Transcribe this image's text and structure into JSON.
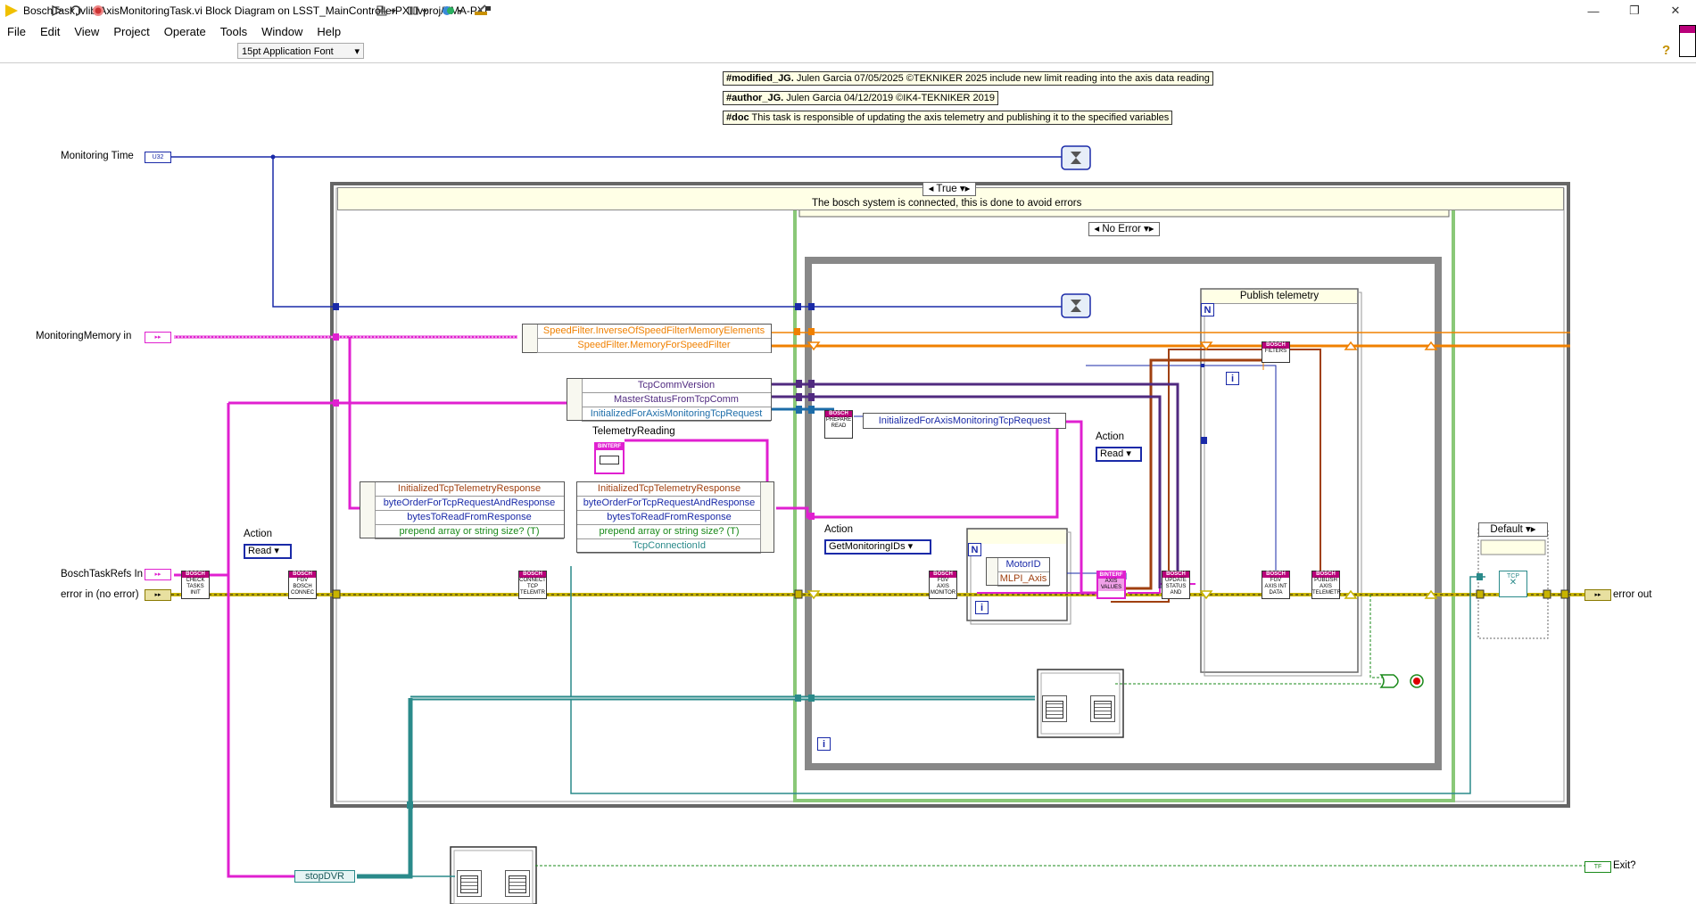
{
  "window": {
    "title": "BoschTask.lvlib:AxisMonitoringTask.vi Block Diagram on LSST_MainControllerPXI.lvproj/TMA-PXI",
    "controls": [
      "—",
      "❐",
      "✕"
    ]
  },
  "menu": [
    "File",
    "Edit",
    "View",
    "Project",
    "Operate",
    "Tools",
    "Window",
    "Help"
  ],
  "toolbar": {
    "font": "15pt Application Font",
    "icons": [
      "run-arrow-icon",
      "run-continuous-icon",
      "abort-icon",
      "align-icon",
      "distribute-icon",
      "reorder-icon",
      "cleanup-icon"
    ],
    "help": "?"
  },
  "comments": [
    {
      "tag": "#modified_JG.",
      "text": " Julen Garcia 07/05/2025 ©TEKNIKER 2025 include new limit reading into the axis data reading"
    },
    {
      "tag": "#author_JG.",
      "text": " Julen Garcia 04/12/2019 ©IK4-TEKNIKER 2019"
    },
    {
      "tag": "#doc",
      "text": " This task is responsible of updating the axis telemetry and publishing it to the specified variables"
    }
  ],
  "terminals": {
    "monitoring_time": "Monitoring Time",
    "monitoring_time_type": "U32",
    "monitoring_memory": "MonitoringMemory in",
    "bosch_task_refs": "BoschTaskRefs In",
    "error_in": "error in (no error)",
    "error_out": "error out",
    "exit": "Exit?",
    "exit_type": "TF",
    "stop_dvr": "stopDVR"
  },
  "outer_case": {
    "selector": "True",
    "comment": "The bosch system is connected, this is done to avoid errors"
  },
  "inner_case": {
    "selector": "No Error"
  },
  "right_case": {
    "selector": "Default"
  },
  "speed_filter": [
    "SpeedFilter.InverseOfSpeedFilterMemoryElements",
    "SpeedFilter.MemoryForSpeedFilter"
  ],
  "tcp_unbundle": [
    "TcpCommVersion",
    "MasterStatusFromTcpComm",
    "InitializedForAxisMonitoringTcpRequest"
  ],
  "telemetry_reading_label": "TelemetryReading",
  "left_bundle": [
    "InitializedTcpTelemetryResponse",
    "byteOrderForTcpRequestAndResponse",
    "bytesToReadFromResponse",
    "prepend array or string size? (T)"
  ],
  "right_bundle": [
    "InitializedTcpTelemetryResponse",
    "byteOrderForTcpRequestAndResponse",
    "bytesToReadFromResponse",
    "prepend array or string size? (T)",
    "TcpConnectionId"
  ],
  "init_request_label": "InitializedForAxisMonitoringTcpRequest",
  "action1": {
    "label": "Action",
    "value": "Read"
  },
  "action2": {
    "label": "Action",
    "value": "Read"
  },
  "action3": {
    "label": "Action",
    "value": "GetMonitoringIDs"
  },
  "motor_bundle": [
    "MotorID",
    "MLPI_Axis"
  ],
  "publish_label": "Publish telemetry",
  "loop_symbols": {
    "n": "N",
    "i": "i"
  },
  "subvis": {
    "check_init": [
      "BOSCH",
      "CHECK",
      "TASKS",
      "INIT",
      "TIMEOUT"
    ],
    "fgv_connect": [
      "BOSCH",
      "FGV",
      "BOSCH",
      "CONNEC"
    ],
    "connect_tcp": [
      "BOSCH",
      "CONNECT",
      "TCP",
      "TELEMTR"
    ],
    "prepare_read": [
      "BOSCH",
      "PREPARE",
      "READ"
    ],
    "fgv_axis_monitor": [
      "BOSCH",
      "FGV",
      "AXIS",
      "MONITOR"
    ],
    "axis_values": [
      "BINTERF",
      "AXIS",
      "VALUES"
    ],
    "update_status": [
      "BOSCH",
      "UPDATE",
      "STATUS",
      "AND"
    ],
    "filters": [
      "BOSCH",
      "FILTERS"
    ],
    "fgv_axis_data": [
      "BOSCH",
      "FGV",
      "AXIS INT",
      "DATA"
    ],
    "publish_axis": [
      "BOSCH",
      "PUBLISH",
      "AXIS",
      "TELEMETR"
    ],
    "binterf": "BINTERF",
    "tcp": "TCP"
  },
  "colors": {
    "blue_wire": "#1a2aa8",
    "pink_wire": "#e020d0",
    "orange_wire": "#f08000",
    "error_wire": "#c8b400",
    "teal_wire": "#2a8a8a",
    "purple_wire": "#502a80",
    "frame_gray": "#888888",
    "sequence_green": "#8ac878"
  }
}
